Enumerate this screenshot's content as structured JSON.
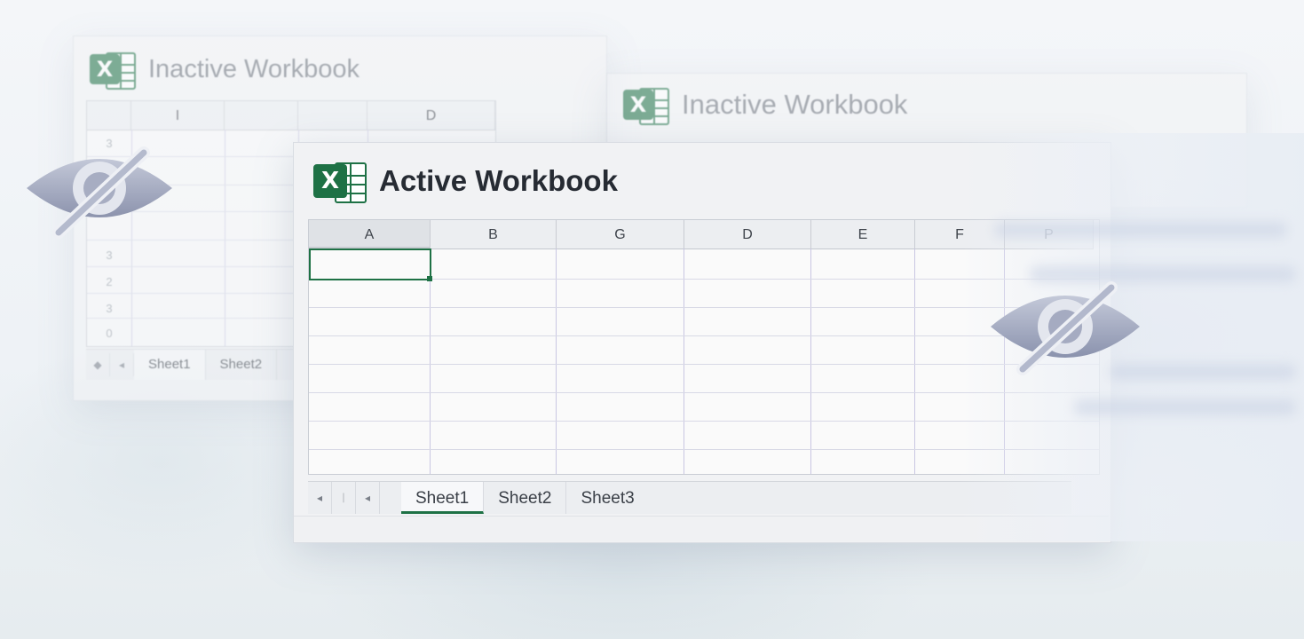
{
  "inactive_left": {
    "title": "Inactive Workbook",
    "column_headers": [
      "",
      "I",
      "",
      "",
      "D"
    ],
    "row_numbers": [
      "3",
      "",
      "",
      "3",
      "2",
      "3",
      "0"
    ],
    "nav": [
      "◆",
      "◂"
    ],
    "tabs": [
      "Sheet1",
      "Sheet2"
    ]
  },
  "inactive_right": {
    "title": "Inactive Workbook"
  },
  "active": {
    "title": "Active Workbook",
    "column_headers": [
      "A",
      "B",
      "G",
      "D",
      "E",
      "F",
      "P"
    ],
    "nav": [
      "◂",
      "ᛁ",
      "◂"
    ],
    "tabs": [
      "Sheet1",
      "Sheet2",
      "Sheet3"
    ],
    "selected_tab": "Sheet1",
    "selected_cell": "A1"
  },
  "icons": {
    "app_icon": "excel-icon",
    "hidden_indicator": "eye-slash-icon"
  },
  "colors": {
    "excel_green": "#1e7145",
    "eye_slash": "#9ea6bd"
  }
}
